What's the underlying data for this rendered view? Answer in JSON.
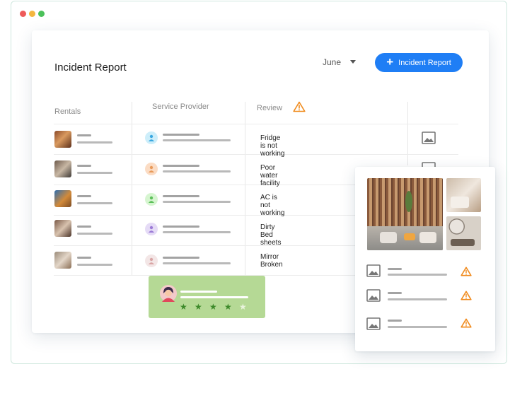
{
  "header": {
    "title": "Incident Report",
    "month": "June",
    "add_button_label": "Incident Report"
  },
  "table": {
    "columns": [
      "Rentals",
      "Service Provider",
      "Review"
    ],
    "rows": [
      {
        "review": "Fridge is not working",
        "avatar_color": "#cdeefa",
        "avatar_icon_color": "#3aa8e0"
      },
      {
        "review": "Poor water facility",
        "avatar_color": "#fbdcc4",
        "avatar_icon_color": "#e89a5a"
      },
      {
        "review": "AC is not working",
        "avatar_color": "#d6f5d0",
        "avatar_icon_color": "#5cc05a"
      },
      {
        "review": "Dirty Bed sheets",
        "avatar_color": "#e5dbf6",
        "avatar_icon_color": "#9b7ad6"
      },
      {
        "review": "Mirror Broken",
        "avatar_color": "#f3e6e6",
        "avatar_icon_color": "#d9a5a5"
      }
    ]
  },
  "rating": {
    "stars": 4,
    "max_stars": 5
  },
  "colors": {
    "accent": "#1f7ef5",
    "warning": "#f08a1c",
    "rating_bg": "#b5d995",
    "star": "#3d8a2a"
  },
  "icons": {
    "add": "plus-icon",
    "dropdown": "chevron-down-icon",
    "warning": "warning-icon",
    "image": "image-icon",
    "user": "user-icon",
    "star": "star-icon"
  }
}
